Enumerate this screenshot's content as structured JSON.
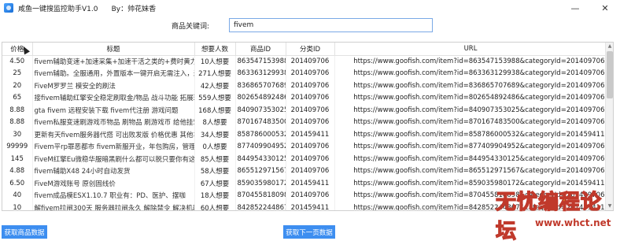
{
  "window": {
    "title": "咸鱼一键搜监控助手V1.0      By：帅花妹香",
    "minimize": "—",
    "close": "✕"
  },
  "search": {
    "label": "商品关键词:",
    "value": "fivem"
  },
  "table": {
    "headers": [
      "价格",
      "标题",
      "想要人数",
      "商品ID",
      "分类ID",
      "URL"
    ],
    "rows": [
      [
        "4.50",
        "fivem辅助变速+加速采集+加速干活之类的+费时黄力刺",
        "10人想要",
        "863547153988",
        "201409706",
        "https://www.goofish.com/item?id=863547153988&categoryId=201409706"
      ],
      [
        "25",
        "fivem辅助。全服通用，外置版本一键开启无需注入，过",
        "271人想要",
        "863363129938",
        "201409706",
        "https://www.goofish.com/item?id=863363129938&categoryId=201409706"
      ],
      [
        "20",
        "FiveM罗罗兰 模安全的刷法",
        "42人想要",
        "836865707689",
        "201409706",
        "https://www.goofish.com/item?id=836865707689&categoryId=201409706"
      ],
      [
        "65",
        "接fivem辅助红擎安全稳定刷取金/物品 战斗功能 拓展环",
        "559人想要",
        "802654892486",
        "201409706",
        "https://www.goofish.com/item?id=802654892486&categoryId=201409706"
      ],
      [
        "8.88",
        "gta fivem 远程安装下载 fivem代注册 游戏问题",
        "168人想要",
        "840907353025",
        "201409706",
        "https://www.goofish.com/item?id=840907353025&categoryId=201409706"
      ],
      [
        "8.88",
        "fivem私服变速刷游戏币物品 刷物品 刷游戏币 给他挂5",
        "8人想要",
        "870167483500",
        "201409706",
        "https://www.goofish.com/item?id=870167483500&categoryId=201409706"
      ],
      [
        "30",
        "更新有天fivem服务器代搭 可出败发版 价格优惠 其他丰",
        "34人想要",
        "858786000532",
        "201459411",
        "https://www.goofish.com/item?id=858786000532&categoryId=201459411"
      ],
      [
        "99999",
        "Fivem平rp罪恶都市 fivem新服开业，年包购房，管理",
        "0人想要",
        "877409904952",
        "201409706",
        "https://www.goofish.com/item?id=877409904952&categoryId=201409706"
      ],
      [
        "145",
        "FiveM红擎Eu微稳华服暗黑刷什么都可以脱只要你有这",
        "85人想要",
        "844954330125",
        "201409706",
        "https://www.goofish.com/item?id=844954330125&categoryId=201409706"
      ],
      [
        "4.88",
        "fivem辅助X48 24小时自动发货",
        "58人想要",
        "865512971567",
        "201409706",
        "https://www.goofish.com/item?id=865512971567&categoryId=201409706"
      ],
      [
        "6.50",
        "FiveM游戏账号 原创固线价",
        "67人想要",
        "859035980172",
        "201459411",
        "https://www.goofish.com/item?id=859035980172&categoryId=201459411"
      ],
      [
        "40",
        "fivem成品模ESX1.10.7 职业有：PD、医护、摆咖",
        "18人想要",
        "870455818098",
        "201409706",
        "https://www.goofish.com/item?id=870455818098&categoryId=201409706"
      ],
      [
        "10",
        "解fivem拉闸300天 服务器拉闸永久 解除禁令 解决机器",
        "60人想要",
        "842852244867",
        "201459411",
        "https://www.goofish.com/item?id=842852244867&categoryId=201459411"
      ],
      [
        "16.88",
        "fivem辅助变速 加速采集 加速干活之类的 费时黄力刺",
        "7人想要",
        "854036863644",
        "201409706",
        "https://www.goofish.com/item?id=854036863644&categoryId=201409706"
      ]
    ]
  },
  "buttons": {
    "fetch": "获取商品数据",
    "next_page": "获取下一页数据"
  },
  "watermark": {
    "main": "无忧编程论坛",
    "url": "www.whct.net"
  },
  "colors": {
    "button_bg": "#3d8ef0",
    "input_border": "#7aa9e6",
    "watermark_fill": "#f1c40f",
    "watermark_stroke": "#c0392b"
  },
  "icons": {
    "app": "fish-app-icon",
    "minimize": "minimize-icon",
    "close": "close-icon"
  }
}
